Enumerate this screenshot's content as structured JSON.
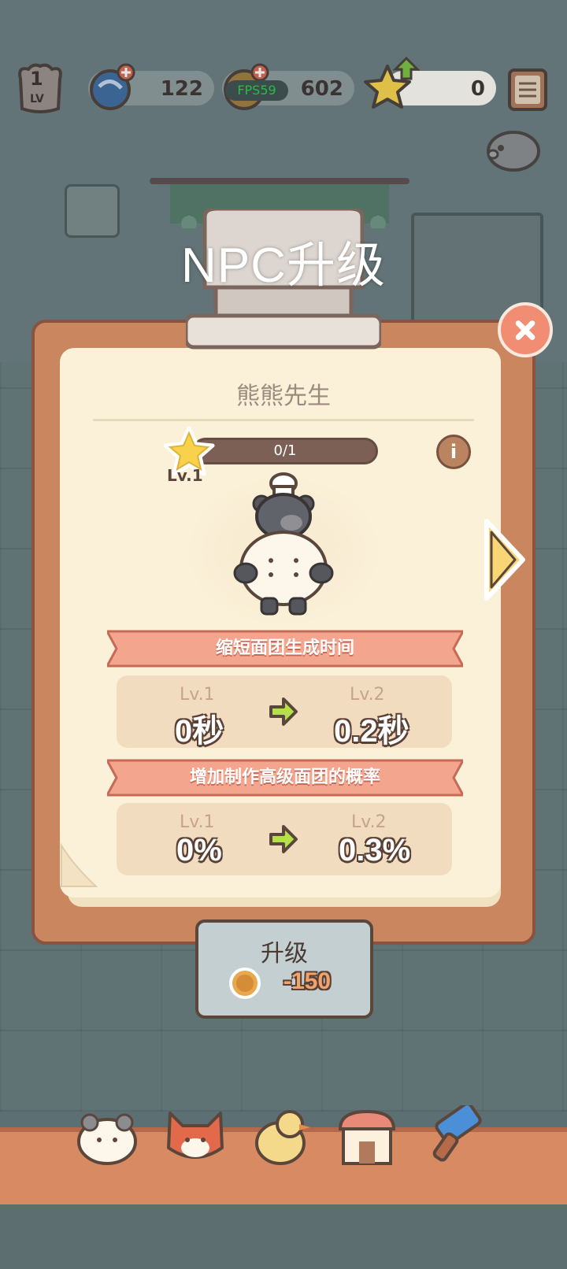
{
  "hud": {
    "level_number": "1",
    "level_suffix": "LV",
    "gems": "122",
    "coins": "602",
    "fps": "FPS59",
    "stars": "0"
  },
  "dialog": {
    "title": "NPC升级",
    "npc_name": "熊熊先生",
    "level_badge": "Lv.1",
    "progress_text": "0/1",
    "progress_fraction": 0,
    "info_icon": "i"
  },
  "stats": [
    {
      "banner": "缩短面团生成时间",
      "from_level": "Lv.1",
      "from_value": "0秒",
      "to_level": "Lv.2",
      "to_value": "0.2秒"
    },
    {
      "banner": "增加制作高级面团的概率",
      "from_level": "Lv.1",
      "from_value": "0%",
      "to_level": "Lv.2",
      "to_value": "0.3%"
    }
  ],
  "upgrade": {
    "label": "升级",
    "cost": "-150"
  },
  "icons": {
    "close": "close-icon",
    "next": "chevron-right-icon",
    "info": "info-icon",
    "star": "star-icon",
    "coin": "coin-icon",
    "gem": "gem-icon",
    "menu": "menu-icon",
    "piggy": "piggy-bank-icon"
  },
  "colors": {
    "banner": "#f4a58d",
    "paper": "#fbf1d8",
    "board": "#c9865f",
    "stat_arrow": "#b5e04a",
    "upgrade_button": "#c3cfd0"
  },
  "bottom_nav": [
    "bear-chef-icon",
    "red-panda-icon",
    "duck-icon",
    "shop-icon",
    "paint-brush-icon"
  ]
}
